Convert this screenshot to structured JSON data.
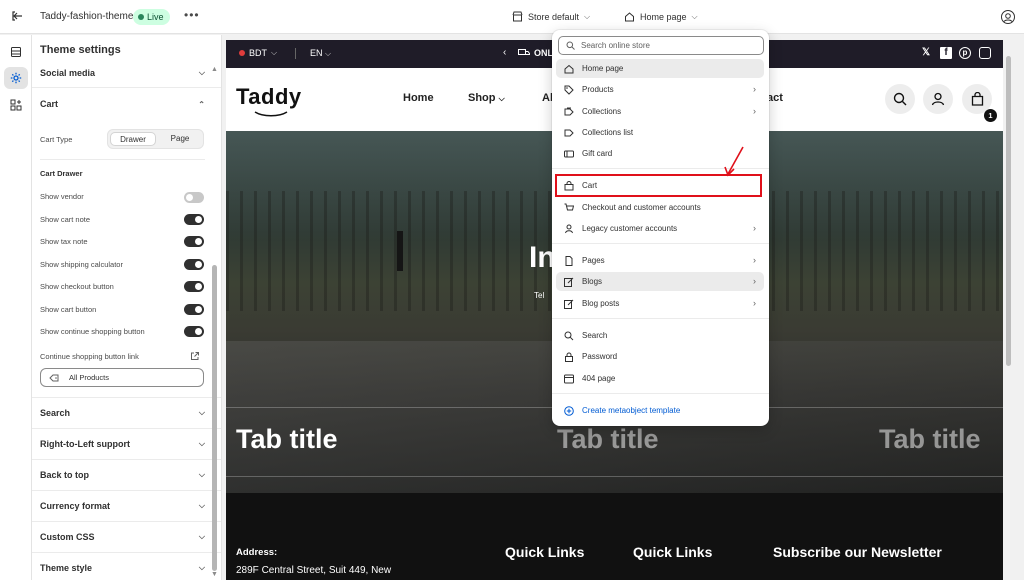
{
  "topbar": {
    "theme_name": "Taddy-fashion-theme",
    "live_badge": "Live",
    "more": "•••",
    "store_selector": "Store default",
    "page_selector": "Home page"
  },
  "settings": {
    "title": "Theme settings",
    "sections_top": [
      {
        "label": "Social media",
        "expanded": false
      },
      {
        "label": "Cart",
        "expanded": true
      }
    ],
    "cart": {
      "cart_type_label": "Cart Type",
      "cart_type_options": [
        "Drawer",
        "Page"
      ],
      "cart_type_selected": "Drawer",
      "drawer_heading": "Cart Drawer",
      "toggles": [
        {
          "label": "Show vendor",
          "on": false
        },
        {
          "label": "Show cart note",
          "on": true
        },
        {
          "label": "Show tax note",
          "on": true
        },
        {
          "label": "Show shipping calculator",
          "on": true
        },
        {
          "label": "Show checkout button",
          "on": true
        },
        {
          "label": "Show cart button",
          "on": true
        },
        {
          "label": "Show continue shopping button",
          "on": true
        }
      ],
      "continue_link_label": "Continue shopping button link",
      "continue_link_value": "All Products"
    },
    "sections_bottom": [
      "Search",
      "Right-to-Left support",
      "Back to top",
      "Currency format",
      "Custom CSS",
      "Theme style"
    ]
  },
  "preview": {
    "announcement": {
      "currency": "BDT",
      "language": "EN",
      "message": "ONL"
    },
    "nav": {
      "logo": "Taddy",
      "links": [
        "Home",
        "Shop",
        "Al",
        "act"
      ],
      "cart_count": "1"
    },
    "hero": {
      "heading_fragment": "In",
      "sub_fragment": "Tel"
    },
    "tab_titles": [
      "Tab title",
      "Tab title",
      "Tab title"
    ],
    "footer": {
      "address_heading": "Address:",
      "address_line": "289F Central Street, Suit 449, New",
      "headings": [
        "Quick Links",
        "Quick Links",
        "Subscribe our Newsletter"
      ]
    }
  },
  "dropdown": {
    "search_placeholder": "Search online store",
    "groups": [
      [
        {
          "label": "Home page",
          "icon": "home-icon",
          "has_sub": false,
          "highlighted": true
        },
        {
          "label": "Products",
          "icon": "tag-icon",
          "has_sub": true
        },
        {
          "label": "Collections",
          "icon": "collection-icon",
          "has_sub": true
        },
        {
          "label": "Collections list",
          "icon": "collection-list-icon",
          "has_sub": false
        },
        {
          "label": "Gift card",
          "icon": "gift-card-icon",
          "has_sub": false
        }
      ],
      [
        {
          "label": "Cart",
          "icon": "cart-bag-icon",
          "has_sub": false
        },
        {
          "label": "Checkout and customer accounts",
          "icon": "checkout-icon",
          "has_sub": false
        },
        {
          "label": "Legacy customer accounts",
          "icon": "person-icon",
          "has_sub": true
        }
      ],
      [
        {
          "label": "Pages",
          "icon": "page-icon",
          "has_sub": true
        },
        {
          "label": "Blogs",
          "icon": "blog-icon",
          "has_sub": true,
          "highlighted": true
        },
        {
          "label": "Blog posts",
          "icon": "blog-post-icon",
          "has_sub": true
        }
      ],
      [
        {
          "label": "Search",
          "icon": "search-icon",
          "has_sub": false
        },
        {
          "label": "Password",
          "icon": "lock-icon",
          "has_sub": false
        },
        {
          "label": "404 page",
          "icon": "error-page-icon",
          "has_sub": false
        }
      ]
    ],
    "create_link": "Create metaobject template"
  },
  "colors": {
    "accent_link": "#005bd3",
    "highlight_red": "#e0101a",
    "announcement_bg": "#1f1c28",
    "live_badge_bg": "#cdfee1"
  }
}
